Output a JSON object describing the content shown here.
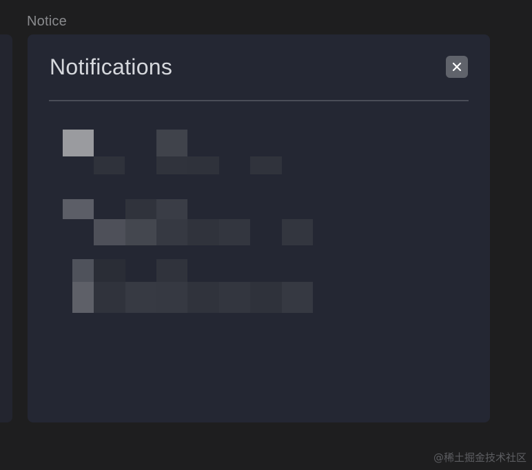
{
  "section": {
    "label": "Notice"
  },
  "notifications": {
    "title": "Notifications",
    "close_icon": "close-icon",
    "content_state": "pixelated / obscured"
  },
  "watermark": {
    "text": "@稀土掘金技术社区"
  },
  "colors": {
    "background": "#1e1e1f",
    "card": "#242733",
    "title_text": "#d6d8dd",
    "close_button": "#60636b",
    "divider": "#4a4d58"
  }
}
